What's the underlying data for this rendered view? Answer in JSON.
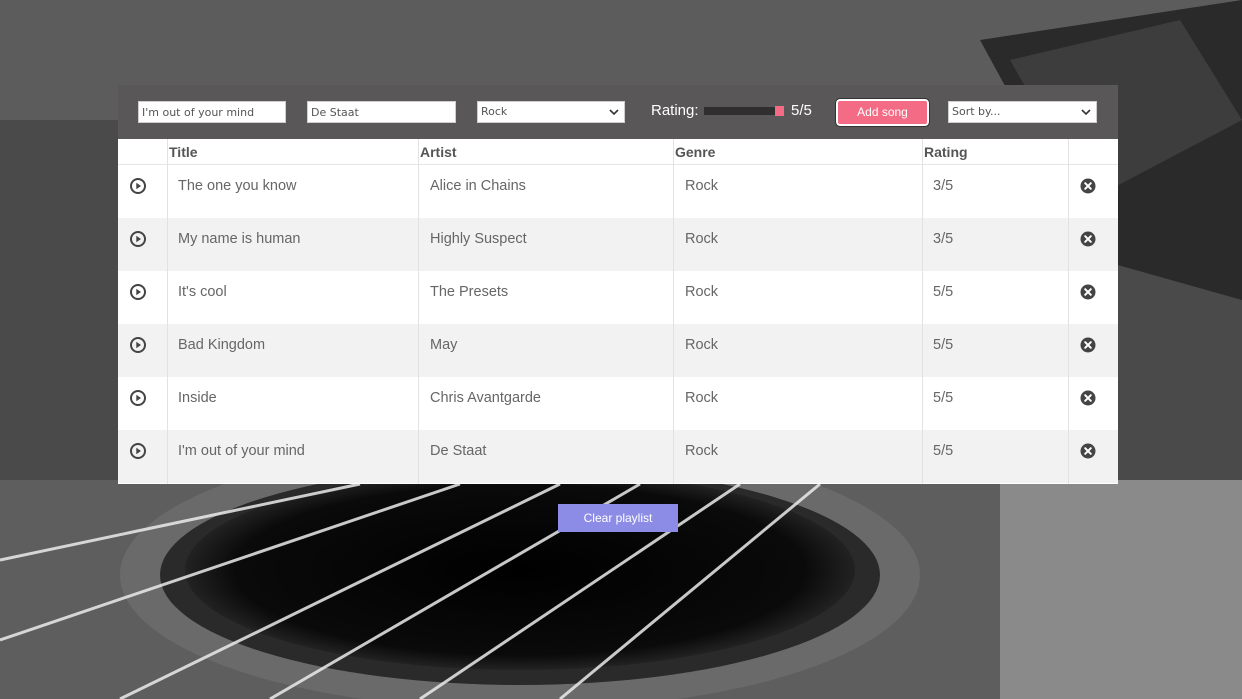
{
  "form": {
    "title_value": "I'm out of your mind",
    "artist_value": "De Staat",
    "genre_selected": "Rock",
    "rating_label": "Rating:",
    "rating_fraction": 1.0,
    "rating_value_text": "5/5",
    "add_button_label": "Add song",
    "sort_selected": "Sort by..."
  },
  "table": {
    "headers": [
      "Title",
      "Artist",
      "Genre",
      "Rating"
    ],
    "rows": [
      {
        "title": "The one you know",
        "artist": "Alice in Chains",
        "genre": "Rock",
        "rating": "3/5"
      },
      {
        "title": "My name is human",
        "artist": "Highly Suspect",
        "genre": "Rock",
        "rating": "3/5"
      },
      {
        "title": "It's cool",
        "artist": "The Presets",
        "genre": "Rock",
        "rating": "5/5"
      },
      {
        "title": "Bad Kingdom",
        "artist": "May",
        "genre": "Rock",
        "rating": "5/5"
      },
      {
        "title": "Inside",
        "artist": "Chris Avantgarde",
        "genre": "Rock",
        "rating": "5/5"
      },
      {
        "title": "I'm out of your mind",
        "artist": "De Staat",
        "genre": "Rock",
        "rating": "5/5"
      }
    ]
  },
  "clear_button_label": "Clear playlist",
  "icons": {
    "row_play": "play-circle-icon",
    "row_delete": "close-circle-icon",
    "select_chevron": "chevron-down-icon"
  },
  "colors": {
    "accent_pink": "#f36b84",
    "clear_button": "#8c8ce6",
    "toolbar_bg": "#595757"
  }
}
